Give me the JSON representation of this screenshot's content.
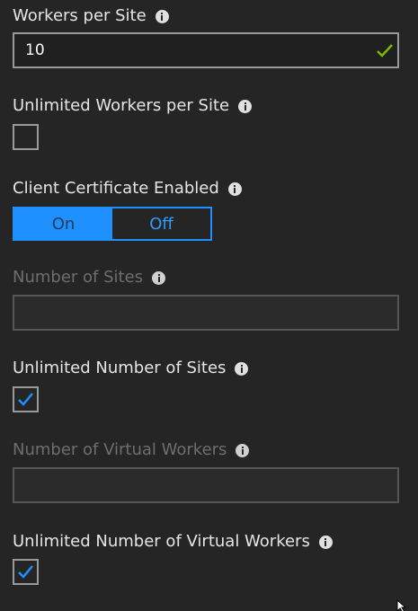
{
  "workers_per_site": {
    "label": "Workers per Site",
    "value": "10",
    "valid": true
  },
  "unlimited_workers_per_site": {
    "label": "Unlimited Workers per Site",
    "checked": false
  },
  "client_certificate": {
    "label": "Client Certificate Enabled",
    "on_label": "On",
    "off_label": "Off",
    "selected": "On"
  },
  "number_of_sites": {
    "label": "Number of Sites",
    "value": "",
    "disabled": true
  },
  "unlimited_number_of_sites": {
    "label": "Unlimited Number of Sites",
    "checked": true
  },
  "number_of_virtual_workers": {
    "label": "Number of Virtual Workers",
    "value": "",
    "disabled": true
  },
  "unlimited_number_of_virtual_workers": {
    "label": "Unlimited Number of Virtual Workers",
    "checked": true
  },
  "colors": {
    "background": "#252525",
    "accent": "#1e90ff",
    "valid": "#7fba00",
    "disabled_text": "#6e6e6e"
  },
  "icons": {
    "info": "info-icon",
    "valid": "checkmark-icon",
    "checkbox_checked": "checkbox-checkmark-icon",
    "cursor": "mouse-cursor-icon"
  }
}
